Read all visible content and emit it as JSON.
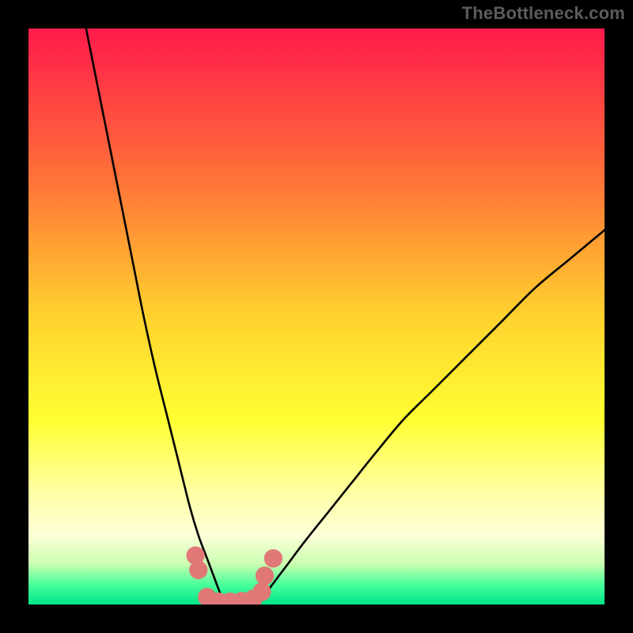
{
  "attribution": "TheBottleneck.com",
  "chart_data": {
    "type": "line",
    "title": "",
    "xlabel": "",
    "ylabel": "",
    "xlim": [
      0,
      100
    ],
    "ylim": [
      0,
      100
    ],
    "grid": false,
    "legend": false,
    "background_gradient": {
      "stops": [
        {
          "offset": 0.0,
          "color": "#ff1a4b"
        },
        {
          "offset": 0.25,
          "color": "#ff6e39"
        },
        {
          "offset": 0.5,
          "color": "#ffd22e"
        },
        {
          "offset": 0.68,
          "color": "#ffff33"
        },
        {
          "offset": 0.8,
          "color": "#ffffa0"
        },
        {
          "offset": 0.88,
          "color": "#fdffd8"
        },
        {
          "offset": 0.93,
          "color": "#c9ffb0"
        },
        {
          "offset": 0.965,
          "color": "#4aff9a"
        },
        {
          "offset": 1.0,
          "color": "#00e58a"
        }
      ]
    },
    "series": [
      {
        "name": "left-curve",
        "x": [
          10,
          12,
          14,
          16,
          18,
          20,
          22,
          24,
          26,
          28,
          29.5,
          31,
          32.5,
          34
        ],
        "y": [
          100,
          90,
          80,
          70,
          60,
          50,
          41,
          33,
          25,
          17,
          12,
          8,
          4,
          0
        ]
      },
      {
        "name": "right-curve",
        "x": [
          40,
          42,
          45,
          48,
          52,
          56,
          60,
          65,
          70,
          76,
          82,
          88,
          94,
          100
        ],
        "y": [
          0,
          3,
          7,
          11,
          16,
          21,
          26,
          32,
          37,
          43,
          49,
          55,
          60,
          65
        ]
      }
    ],
    "bottom_marks": {
      "name": "bottom-cluster",
      "color": "#e07878",
      "radius_pct": 1.6,
      "points": [
        {
          "x": 29.0,
          "y": 8.5
        },
        {
          "x": 29.5,
          "y": 6.0
        },
        {
          "x": 31.0,
          "y": 1.3
        },
        {
          "x": 33.0,
          "y": 0.5
        },
        {
          "x": 35.0,
          "y": 0.5
        },
        {
          "x": 37.0,
          "y": 0.6
        },
        {
          "x": 39.0,
          "y": 1.0
        },
        {
          "x": 40.5,
          "y": 2.2
        },
        {
          "x": 41.0,
          "y": 5.0
        },
        {
          "x": 42.5,
          "y": 8.0
        }
      ]
    }
  }
}
